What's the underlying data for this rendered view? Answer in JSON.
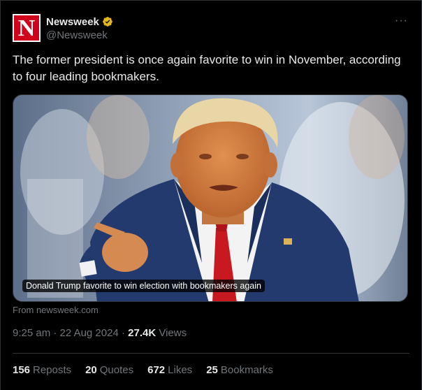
{
  "account": {
    "logo_letter": "N",
    "display_name": "Newsweek",
    "handle": "@Newsweek",
    "verified_color": "#e2b719"
  },
  "more_icon": "more-horizontal-icon",
  "tweet_text": "The former president is once again favorite to win in November, according to four leading bookmakers.",
  "card": {
    "caption": "Donald Trump favorite to win election with bookmakers again",
    "source": "From newsweek.com"
  },
  "meta": {
    "time": "9:25 am",
    "date": "22 Aug 2024",
    "views_count": "27.4K",
    "views_label": "Views"
  },
  "stats": {
    "reposts_count": "156",
    "reposts_label": "Reposts",
    "quotes_count": "20",
    "quotes_label": "Quotes",
    "likes_count": "672",
    "likes_label": "Likes",
    "bookmarks_count": "25",
    "bookmarks_label": "Bookmarks"
  },
  "colors": {
    "background": "#000000",
    "text": "#e7e9ea",
    "muted": "#71767b",
    "logo_red": "#d0021b"
  }
}
